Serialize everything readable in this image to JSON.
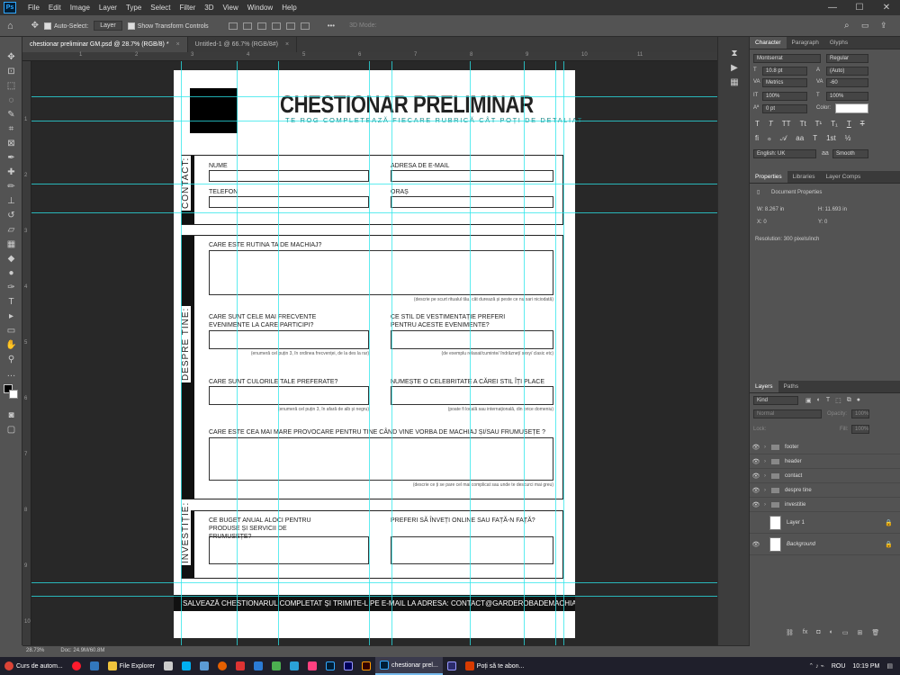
{
  "menubar": {
    "logo": "Ps",
    "items": [
      "File",
      "Edit",
      "Image",
      "Layer",
      "Type",
      "Select",
      "Filter",
      "3D",
      "View",
      "Window",
      "Help"
    ],
    "min": "—",
    "max": "☐",
    "close": "✕"
  },
  "options": {
    "auto_select": "Auto-Select:",
    "auto_select_value": "Layer",
    "show_transform": "Show Transform Controls",
    "mode_3d": "3D Mode:"
  },
  "tabs": [
    {
      "label": "chestionar preliminar GM.psd @ 28.7% (RGB/8) *",
      "close": "×"
    },
    {
      "label": "Untitled-1 @ 66.7% (RGB/8#)",
      "close": "×"
    }
  ],
  "ruler": {
    "top": [
      "1",
      "2",
      "3",
      "4",
      "5",
      "6",
      "7",
      "8",
      "9",
      "10",
      "11"
    ],
    "left": [
      "1",
      "2",
      "3",
      "4",
      "5",
      "6",
      "7",
      "8",
      "9",
      "10",
      "11"
    ]
  },
  "document": {
    "title": "CHESTIONAR PRELIMINAR",
    "subtitle": "TE ROG COMPLETEAZĂ FIECARE RUBRICĂ CÂT POȚI DE DETALIAT",
    "contact": {
      "label": "CONTACT:",
      "nume": "NUME",
      "email": "ADRESA DE E-MAIL",
      "telefon": "TELEFON",
      "oras": "ORAȘ"
    },
    "despre": {
      "label": "DESPRE TINE:",
      "q1": "CARE ESTE RUTINA TA DE MACHIAJ?",
      "h1": "(descrie pe scurt ritualul tău, cât durează și peste ce nu sari niciodată)",
      "q2": "CARE SUNT CELE MAI FRECVENTE EVENIMENTE LA CARE PARTICIPI?",
      "h2": "(enumeră cel puțin 3, în ordinea frecvenței, de la des la rar)",
      "q3": "CE STIL DE VESTIMENTAȚIE PREFERI PENTRU ACESTE EVENIMENTE?",
      "h3": "(de exemplu relaxat/cuminte/ îndrăzneț/ sexy/ clasic etc)",
      "q4": "CARE SUNT CULORILE TALE PREFERATE?",
      "h4": "(enumeră cel puțin 3, în afară de alb și negru)",
      "q5": "NUMEȘTE O CELEBRITATE A CĂREI STIL ÎȚI PLACE",
      "h5": "(poate fi locală sau internațională, din orice domeniu)",
      "q6": "CARE ESTE CEA MAI MARE PROVOCARE PENTRU TINE CÂND VINE VORBA DE MACHIAJ ȘI/SAU FRUMUSEȚE ?",
      "h6": "(descrie ce ți se pare cel mai complicat sau unde te descurci mai greu)"
    },
    "investitie": {
      "label": "INVESTIȚIE:",
      "q1": "CE BUGET ANUAL ALOCI PENTRU PRODUSE ȘI SERVICII DE FRUMUSEȚE?",
      "q2": "PREFERI SĂ ÎNVEȚI ONLINE SAU FAȚĂ-N FAȚĂ?"
    },
    "footer": "SALVEAZĂ CHESTIONARUL COMPLETAT ȘI TRIMITE-L PE E-MAIL LA ADRESA: CONTACT@GARDEROBADEMACHIAJ.RO"
  },
  "character": {
    "tabs": [
      "Character",
      "Paragraph",
      "Glyphs"
    ],
    "font": "Montserrat",
    "style": "Regular",
    "size": "10.8 pt",
    "leading": "(Auto)",
    "kerning": "Metrics",
    "tracking": "-60",
    "vscale": "100%",
    "hscale": "100%",
    "baseline": "0 pt",
    "color_label": "Color:",
    "language": "English: UK",
    "aa": "Smooth"
  },
  "properties": {
    "tabs": [
      "Properties",
      "Libraries",
      "Layer Comps"
    ],
    "doc": "Document Properties",
    "w": "W:  8.267 in",
    "h": "H:  11.693 in",
    "x": "X:  0",
    "y": "Y:  0",
    "res": "Resolution: 300 pixels/inch"
  },
  "layers": {
    "tabs": [
      "Layers",
      "Paths"
    ],
    "kind": "Kind",
    "blend": "Normal",
    "opacity": "Opacity:",
    "opacity_val": "100%",
    "lock": "Lock:",
    "fill": "Fill:",
    "fill_val": "100%",
    "items": [
      {
        "name": "footer",
        "type": "folder"
      },
      {
        "name": "header",
        "type": "folder"
      },
      {
        "name": "contact",
        "type": "folder"
      },
      {
        "name": "despre tine",
        "type": "folder"
      },
      {
        "name": "investitie",
        "type": "folder"
      },
      {
        "name": "Layer 1",
        "type": "pixel"
      },
      {
        "name": "Background",
        "type": "pixel"
      }
    ]
  },
  "status": {
    "zoom": "28.73%",
    "doc": "Doc: 24.9M/60.8M"
  },
  "taskbar": {
    "items": [
      "Curs de autom...",
      "File Explorer",
      "chestionar prel...",
      "Poți să te abon..."
    ],
    "lang": "ROU",
    "time": "10:19 PM"
  },
  "colors": {
    "accent": "#31a8ff",
    "guide": "#29e6ea",
    "teal_subtitle": "#1a8a8a"
  }
}
